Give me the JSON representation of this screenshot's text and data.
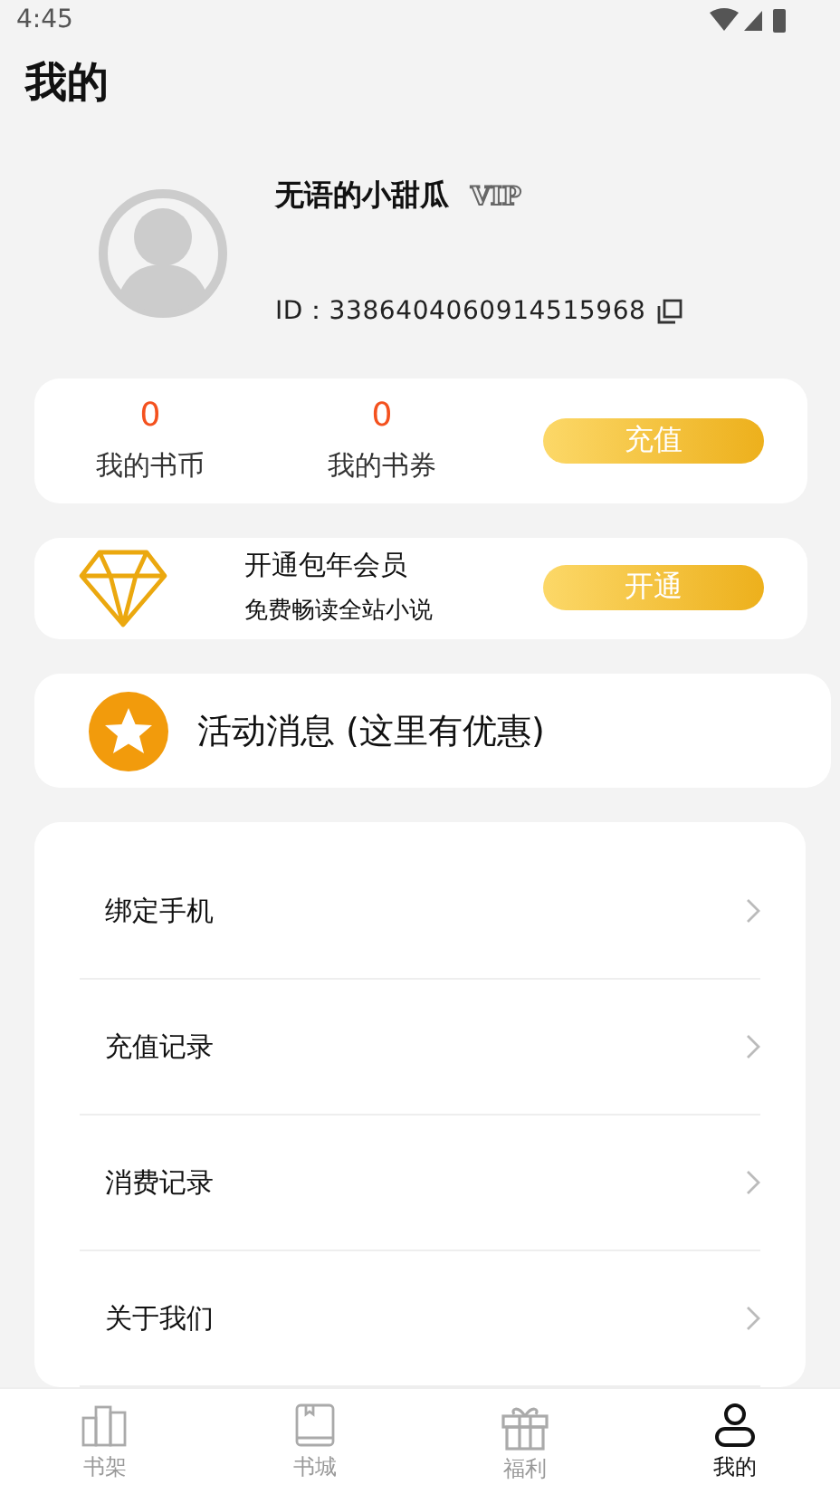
{
  "status_bar": {
    "time": "4:45"
  },
  "title": "我的",
  "profile": {
    "name": "无语的小甜瓜",
    "badge": "VIP",
    "id": "ID：3386404060914515968"
  },
  "wallet": {
    "stats": [
      {
        "value": "0",
        "label": "我的书币"
      },
      {
        "value": "0",
        "label": "我的书券"
      }
    ],
    "button": "充值"
  },
  "vip": {
    "title": "开通包年会员",
    "subtitle": "免费畅读全站小说",
    "button": "开通"
  },
  "activity": "活动消息 (这里有优惠)",
  "menu": [
    "绑定手机",
    "充值记录",
    "消费记录",
    "关于我们"
  ],
  "nav": [
    {
      "label": "书架",
      "kind": "shelf",
      "selected": false
    },
    {
      "label": "书城",
      "kind": "store",
      "selected": false
    },
    {
      "label": "福利",
      "kind": "gift",
      "selected": false
    },
    {
      "label": "我的",
      "kind": "user",
      "selected": true
    }
  ]
}
